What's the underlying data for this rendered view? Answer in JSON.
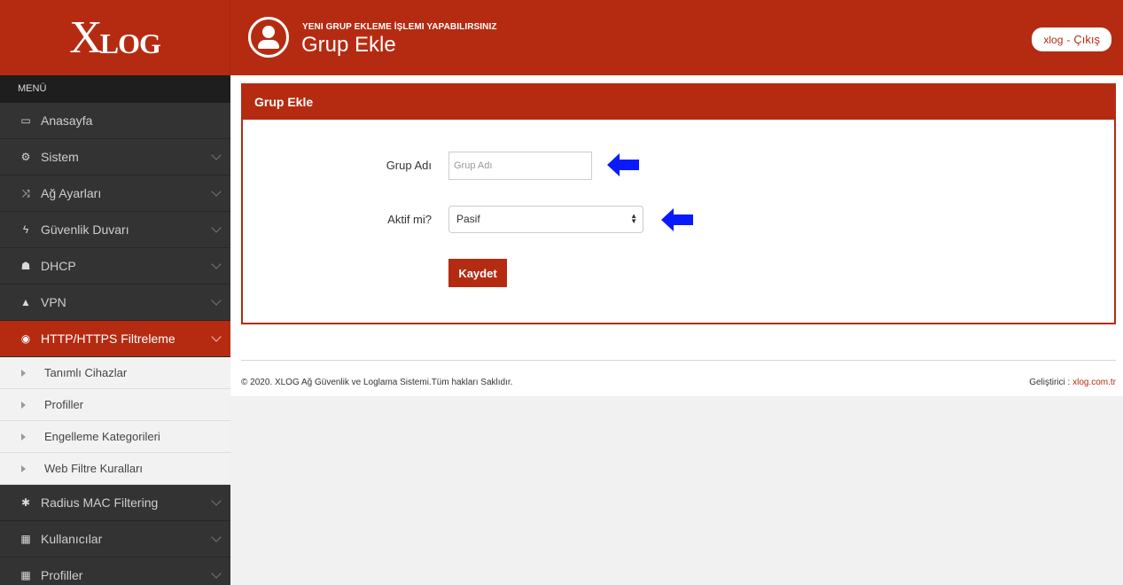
{
  "brand": {
    "logo_x": "X",
    "logo_rest": "LOG"
  },
  "sidebar": {
    "menu_title": "MENÜ",
    "items": [
      {
        "label": "Anasayfa",
        "icon": "laptop-icon",
        "glyph": "▭"
      },
      {
        "label": "Sistem",
        "icon": "cogs-icon",
        "glyph": "⚙"
      },
      {
        "label": "Ağ Ayarları",
        "icon": "random-icon",
        "glyph": "⤨"
      },
      {
        "label": "Güvenlik Duvarı",
        "icon": "bolt-icon",
        "glyph": "ϟ"
      },
      {
        "label": "DHCP",
        "icon": "sitemap-icon",
        "glyph": "☗"
      },
      {
        "label": "VPN",
        "icon": "road-icon",
        "glyph": "▲"
      },
      {
        "label": "HTTP/HTTPS Filtreleme",
        "icon": "eye-slash-icon",
        "glyph": "◉"
      }
    ],
    "subitems": [
      {
        "label": "Tanımlı Cihazlar"
      },
      {
        "label": "Profiller"
      },
      {
        "label": "Engelleme Kategorileri"
      },
      {
        "label": "Web Filtre Kuralları"
      }
    ],
    "items_after": [
      {
        "label": "Radius MAC Filtering",
        "icon": "asterisk-icon",
        "glyph": "✱"
      },
      {
        "label": "Kullanıcılar",
        "icon": "th-large-icon",
        "glyph": "▦"
      },
      {
        "label": "Profiller",
        "icon": "th-large-icon",
        "glyph": "▦"
      }
    ]
  },
  "header": {
    "subtitle": "YENI GRUP EKLEME İŞLEMI YAPABILIRSINIZ",
    "title": "Grup Ekle",
    "user": "xlog",
    "separator": "-",
    "logout": "Çıkış"
  },
  "panel": {
    "title": "Grup Ekle",
    "group_name_label": "Grup Adı",
    "group_name_placeholder": "Grup Adı",
    "active_label": "Aktif mi?",
    "active_value": "Pasif",
    "save_label": "Kaydet"
  },
  "footer": {
    "copyright": "© 2020. XLOG Ağ Güvenlik ve Loglama Sistemi.Tüm hakları Saklıdır.",
    "developer_label": "Geliştirici :",
    "developer_link": "xlog.com.tr"
  },
  "colors": {
    "brand": "#b52b12",
    "sidebar": "#333333",
    "annotation_arrow": "#0a1aff"
  }
}
